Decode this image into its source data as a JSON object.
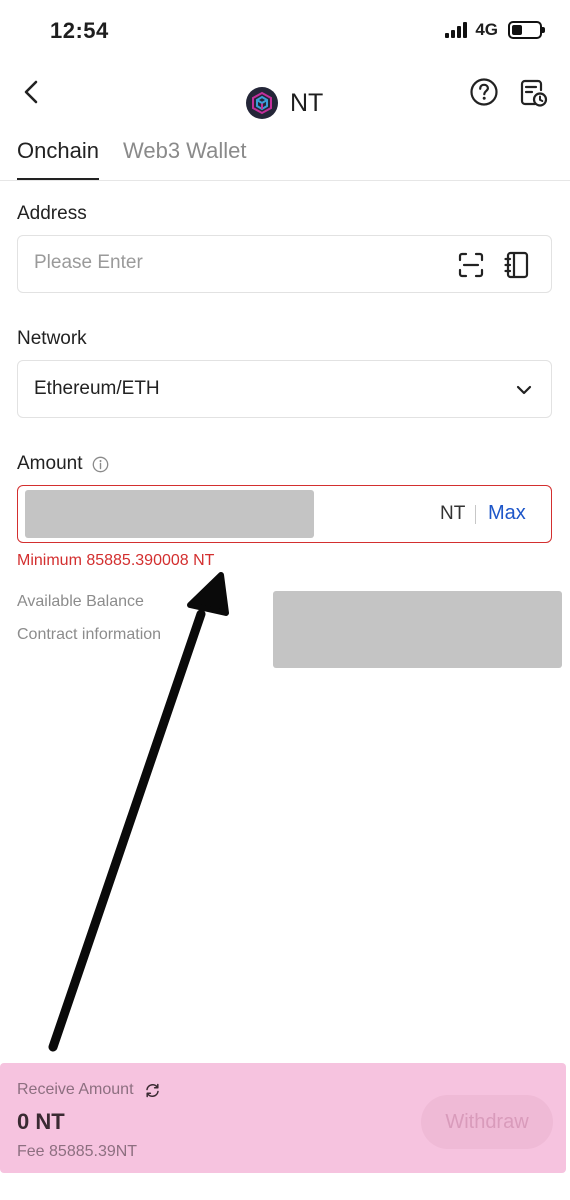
{
  "status_bar": {
    "time": "12:54",
    "network": "4G"
  },
  "header": {
    "coin": "NT"
  },
  "tabs": [
    {
      "label": "Onchain"
    },
    {
      "label": "Web3 Wallet"
    }
  ],
  "address": {
    "label": "Address",
    "placeholder": "Please Enter"
  },
  "network": {
    "label": "Network",
    "value": "Ethereum/ETH"
  },
  "amount": {
    "label": "Amount",
    "unit": "NT",
    "max_label": "Max",
    "error": "Minimum 85885.390008 NT"
  },
  "details": {
    "available_balance_label": "Available Balance",
    "contract_info_label": "Contract information"
  },
  "footer": {
    "receive_label": "Receive Amount",
    "receive_value": "0 NT",
    "fee": "Fee 85885.39NT",
    "withdraw_label": "Withdraw"
  },
  "colors": {
    "error": "#d32f2f",
    "link": "#1d56c9",
    "footer_bg": "#f6c3df"
  }
}
